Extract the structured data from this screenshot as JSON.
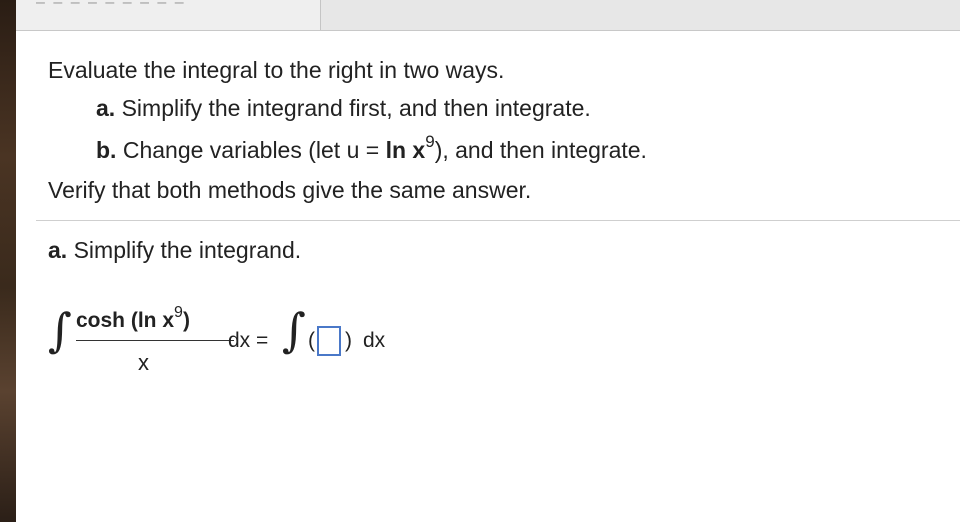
{
  "top_bar": {
    "tab_text": "– – – – – – – – –"
  },
  "question": {
    "intro": "Evaluate the integral to the right in two ways.",
    "part_a_label": "a.",
    "part_a_text": " Simplify the integrand first, and then integrate.",
    "part_b_label": "b.",
    "part_b_text_pre": " Change variables (let u = ",
    "part_b_bold": "ln x",
    "part_b_exp": "9",
    "part_b_text_post": "), and then integrate.",
    "verify": "Verify that both methods give the same answer."
  },
  "section": {
    "label": "a.",
    "text": " Simplify the integrand."
  },
  "equation": {
    "numerator": "cosh (ln x",
    "numerator_exp": "9",
    "numerator_close": ")",
    "denominator": "x",
    "dx_equals": "dx =",
    "open_paren": "(",
    "close_paren": ")",
    "dx": "dx",
    "answer_value": ""
  }
}
